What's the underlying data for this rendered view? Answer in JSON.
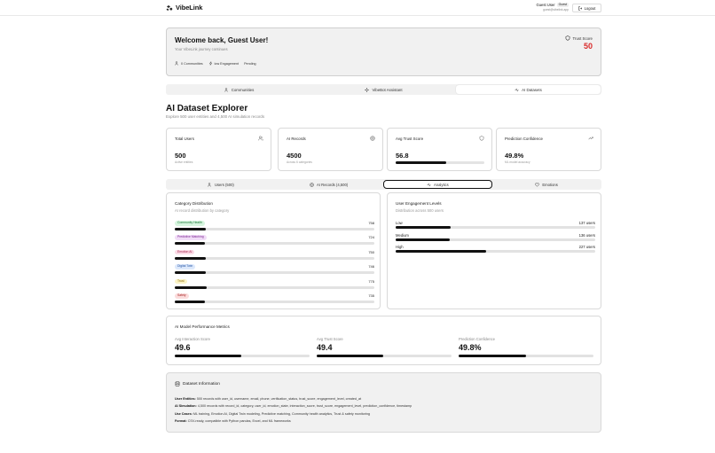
{
  "header": {
    "app_name": "VibeLink",
    "user_name": "Guest User",
    "badge": "Guest",
    "email": "guest@vibelink.app",
    "logout_label": "Logout"
  },
  "welcome": {
    "title": "Welcome back, Guest User!",
    "subtitle": "Your VibeLink journey continues",
    "tags": [
      "0 Communities",
      "low Engagement",
      "Pending"
    ],
    "trust_label": "Trust Score",
    "trust_value": "50",
    "trust_color": "#d92b2b"
  },
  "main_tabs": [
    {
      "label": "Communities",
      "icon": "users-icon",
      "active": false
    },
    {
      "label": "VibeBot Assistant",
      "icon": "sparkles-icon",
      "active": false
    },
    {
      "label": "AI Datasets",
      "icon": "activity-icon",
      "active": true
    }
  ],
  "page": {
    "title": "AI Dataset Explorer",
    "subtitle": "Explore 500 user entities and 4,500 AI simulation records"
  },
  "stats": [
    {
      "title": "Total Users",
      "value": "500",
      "sub": "Active entities",
      "icon": "users-icon"
    },
    {
      "title": "AI Records",
      "value": "4500",
      "sub": "Across 6 categories",
      "icon": "target-icon"
    },
    {
      "title": "Avg Trust Score",
      "value": "56.8",
      "progress": 0.568,
      "icon": "shield-icon"
    },
    {
      "title": "Prediction Confidence",
      "value": "49.8%",
      "sub": "ML model accuracy",
      "icon": "trend-icon"
    }
  ],
  "sub_tabs": [
    {
      "label": "Users (500)",
      "icon": "users-icon",
      "active": false
    },
    {
      "label": "AI Records (4,500)",
      "icon": "target-icon",
      "active": false
    },
    {
      "label": "Analytics",
      "icon": "activity-icon",
      "active": true
    },
    {
      "label": "Emotions",
      "icon": "heart-icon",
      "active": false
    }
  ],
  "category_panel": {
    "title": "Category Distribution",
    "subtitle": "AI record distribution by category",
    "max": 775,
    "items": [
      {
        "label": "Community Health",
        "value": 758,
        "bg": "#d7f5df",
        "fg": "#1c7a3a"
      },
      {
        "label": "Predictive Matching",
        "value": 724,
        "bg": "#f1dcf7",
        "fg": "#7a2390"
      },
      {
        "label": "Emotion AI",
        "value": 750,
        "bg": "#fbdbe6",
        "fg": "#a3204c"
      },
      {
        "label": "Digital Twin",
        "value": 746,
        "bg": "#dce8fb",
        "fg": "#2455a3"
      },
      {
        "label": "Trust",
        "value": 775,
        "bg": "#fbf3c6",
        "fg": "#8a6b07"
      },
      {
        "label": "Safety",
        "value": 735,
        "bg": "#fbdcdc",
        "fg": "#a42121"
      }
    ]
  },
  "engagement_panel": {
    "title": "User Engagement Levels",
    "subtitle": "Distribution across 500 users",
    "total": 500,
    "items": [
      {
        "label": "Low",
        "value": 137,
        "text": "137 users"
      },
      {
        "label": "Medium",
        "value": 136,
        "text": "136 users"
      },
      {
        "label": "High",
        "value": 227,
        "text": "227 users"
      }
    ]
  },
  "metrics_panel": {
    "title": "AI Model Performance Metrics",
    "items": [
      {
        "label": "Avg Interaction Score",
        "value": "49.6",
        "progress": 0.496
      },
      {
        "label": "Avg Trust Score",
        "value": "49.4",
        "progress": 0.494
      },
      {
        "label": "Prediction Confidence",
        "value": "49.8%",
        "progress": 0.498
      }
    ]
  },
  "info": {
    "title": "Dataset Information",
    "lines": [
      {
        "key": "User Entities:",
        "text": "500 records with user_id, username, email, phone, verification_status, trust_score, engagement_level, created_at"
      },
      {
        "key": "AI Simulation:",
        "text": "4,500 records with record_id, category, user_id, emotion_state, interaction_score, trust_score, engagement_level, prediction_confidence, timestamp"
      },
      {
        "key": "Use Cases:",
        "text": "ML training, Emotion AI, Digital Twin modeling, Predictive matching, Community health analytics, Trust & safety monitoring"
      },
      {
        "key": "Format:",
        "text": "CSV-ready, compatible with Python pandas, Excel, and ML frameworks"
      }
    ]
  }
}
